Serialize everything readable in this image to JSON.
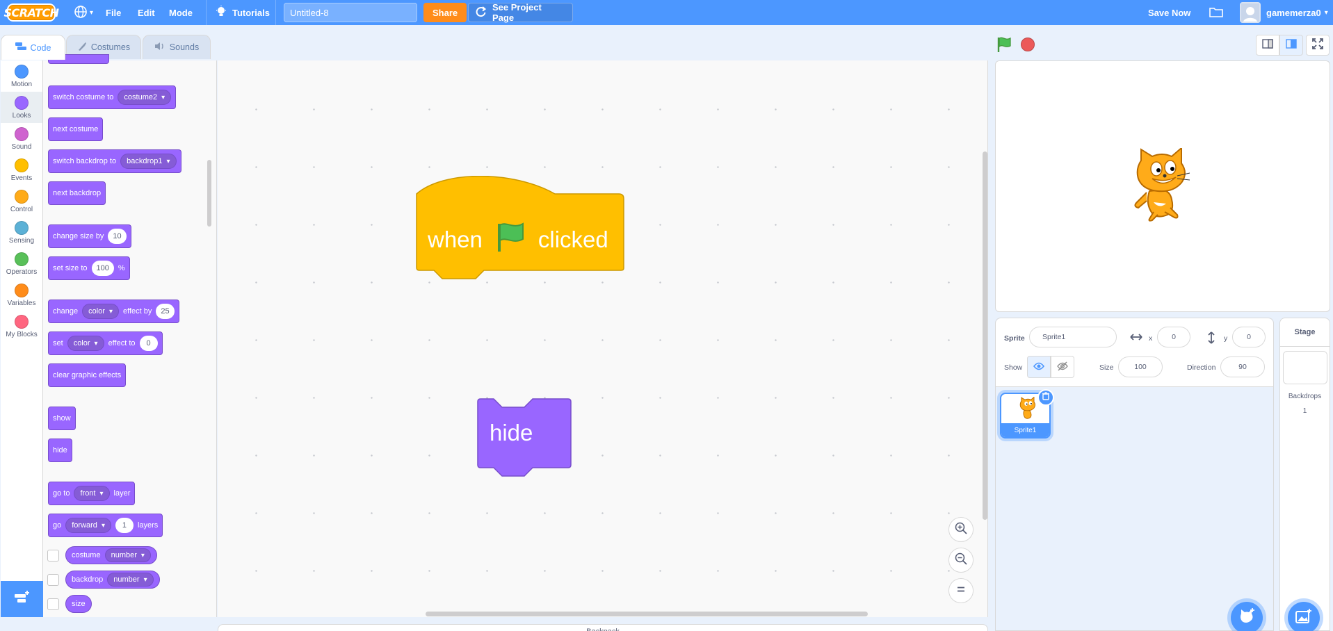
{
  "menubar": {
    "logo": "SCRATCH",
    "file": "File",
    "edit": "Edit",
    "mode": "Mode",
    "tutorials": "Tutorials",
    "project_title": "Untitled-8",
    "share": "Share",
    "see_project_page": "See Project Page",
    "save_now": "Save Now",
    "username": "gamemerza0"
  },
  "tabs": {
    "code": "Code",
    "costumes": "Costumes",
    "sounds": "Sounds"
  },
  "categories": [
    {
      "label": "Motion",
      "color": "#4c97ff"
    },
    {
      "label": "Looks",
      "color": "#9966ff"
    },
    {
      "label": "Sound",
      "color": "#cf63cf"
    },
    {
      "label": "Events",
      "color": "#ffbf00"
    },
    {
      "label": "Control",
      "color": "#ffab19"
    },
    {
      "label": "Sensing",
      "color": "#5cb1d6"
    },
    {
      "label": "Operators",
      "color": "#59c059"
    },
    {
      "label": "Variables",
      "color": "#ff8c1a"
    },
    {
      "label": "My Blocks",
      "color": "#ff6680"
    }
  ],
  "palette": {
    "switch_costume": {
      "label": "switch costume to",
      "value": "costume2"
    },
    "next_costume": "next costume",
    "switch_backdrop": {
      "label": "switch backdrop to",
      "value": "backdrop1"
    },
    "next_backdrop": "next backdrop",
    "change_size": {
      "label": "change size by",
      "value": "10"
    },
    "set_size": {
      "label": "set size to",
      "value": "100",
      "unit": "%"
    },
    "change_effect": {
      "label": "change",
      "effect": "color",
      "label2": "effect by",
      "value": "25"
    },
    "set_effect": {
      "label": "set",
      "effect": "color",
      "label2": "effect to",
      "value": "0"
    },
    "clear_effects": "clear graphic effects",
    "show": "show",
    "hide": "hide",
    "go_to_layer": {
      "label": "go to",
      "value": "front",
      "label2": "layer"
    },
    "go_layers": {
      "label": "go",
      "value": "forward",
      "num": "1",
      "label2": "layers"
    },
    "costume_reporter": {
      "label": "costume",
      "value": "number"
    },
    "backdrop_reporter": {
      "label": "backdrop",
      "value": "number"
    },
    "size_reporter": "size"
  },
  "workspace": {
    "hat_when": "when",
    "hat_clicked": "clicked",
    "hide_block": "hide"
  },
  "backpack": "Backpack",
  "sprite_info": {
    "sprite_label": "Sprite",
    "sprite_name": "Sprite1",
    "x_label": "x",
    "x_value": "0",
    "y_label": "y",
    "y_value": "0",
    "show_label": "Show",
    "size_label": "Size",
    "size_value": "100",
    "direction_label": "Direction",
    "direction_value": "90"
  },
  "sprites": [
    {
      "name": "Sprite1"
    }
  ],
  "stage_pane": {
    "header": "Stage",
    "backdrops_label": "Backdrops",
    "backdrops_count": "1"
  },
  "colors": {
    "menubar": "#4c97ff",
    "looks": "#9966ff",
    "events": "#ffbf00",
    "share": "#ff8c1a"
  }
}
